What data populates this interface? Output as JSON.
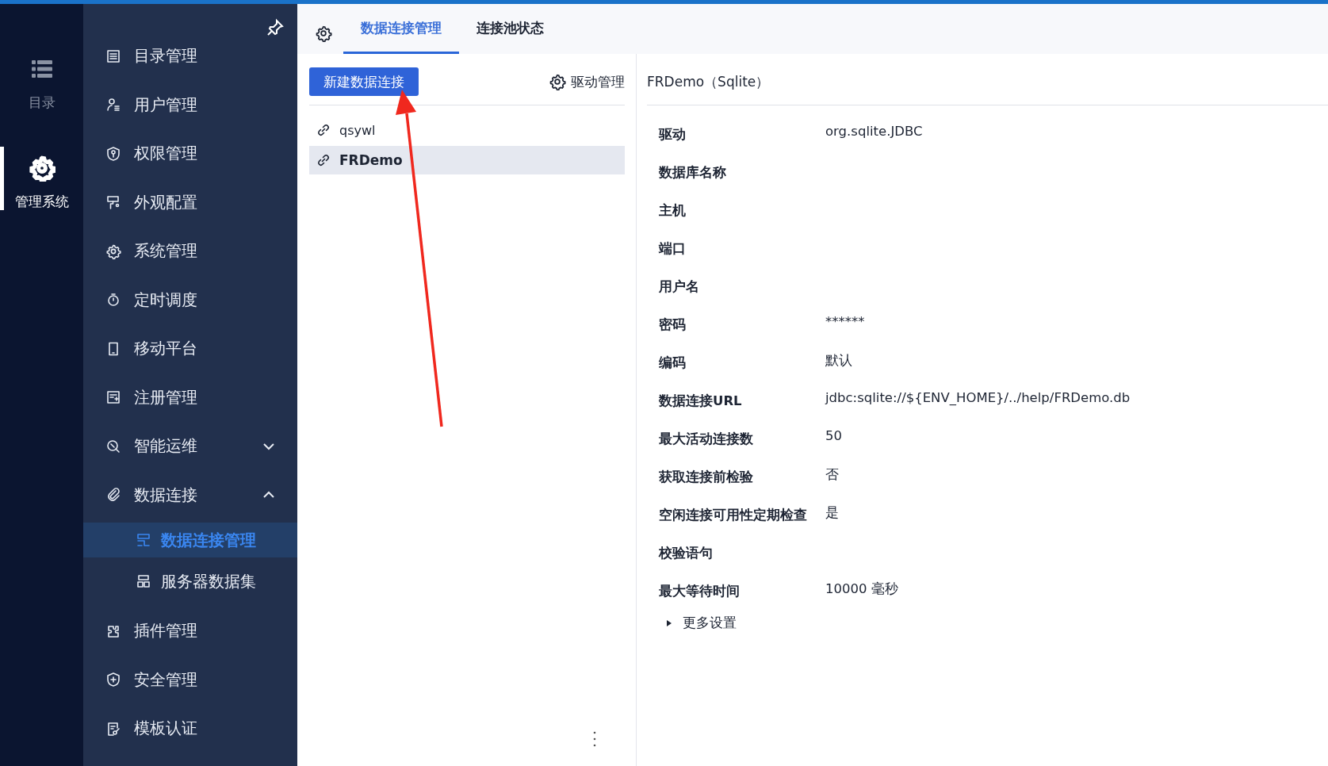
{
  "rail": [
    {
      "label": "目录",
      "selected": false
    },
    {
      "label": "管理系统",
      "selected": true
    }
  ],
  "sidebar": {
    "items": [
      {
        "label": "目录管理"
      },
      {
        "label": "用户管理"
      },
      {
        "label": "权限管理"
      },
      {
        "label": "外观配置"
      },
      {
        "label": "系统管理"
      },
      {
        "label": "定时调度"
      },
      {
        "label": "移动平台"
      },
      {
        "label": "注册管理"
      },
      {
        "label": "智能运维",
        "expanded": false
      },
      {
        "label": "数据连接",
        "expanded": true,
        "children": [
          {
            "label": "数据连接管理",
            "selected": true
          },
          {
            "label": "服务器数据集",
            "selected": false
          }
        ]
      },
      {
        "label": "插件管理"
      },
      {
        "label": "安全管理"
      },
      {
        "label": "模板认证"
      }
    ]
  },
  "tabs": [
    {
      "label": "数据连接管理",
      "selected": true
    },
    {
      "label": "连接池状态",
      "selected": false
    }
  ],
  "new_button": "新建数据连接",
  "driver_button": "驱动管理",
  "connections": [
    {
      "name": "qsywl",
      "selected": false
    },
    {
      "name": "FRDemo",
      "selected": true
    }
  ],
  "detail": {
    "title": "FRDemo（Sqlite）",
    "rows": [
      {
        "label": "驱动",
        "value": "org.sqlite.JDBC"
      },
      {
        "label": "数据库名称"
      },
      {
        "label": "主机"
      },
      {
        "label": "端口"
      },
      {
        "label": "用户名"
      },
      {
        "label": "密码",
        "value": "******"
      },
      {
        "label": "编码",
        "value": "默认"
      },
      {
        "label": "数据连接URL",
        "value": "jdbc:sqlite://${ENV_HOME}/../help/FRDemo.db"
      },
      {
        "label": "最大活动连接数",
        "value": "50"
      },
      {
        "label": "获取连接前检验",
        "value": "否"
      },
      {
        "label": "空闲连接可用性定期检查",
        "value": "是"
      },
      {
        "label": "校验语句"
      },
      {
        "label": "最大等待时间",
        "value": "10000 毫秒"
      }
    ],
    "more": {
      "label": "更多设置",
      "expanded": false
    }
  }
}
